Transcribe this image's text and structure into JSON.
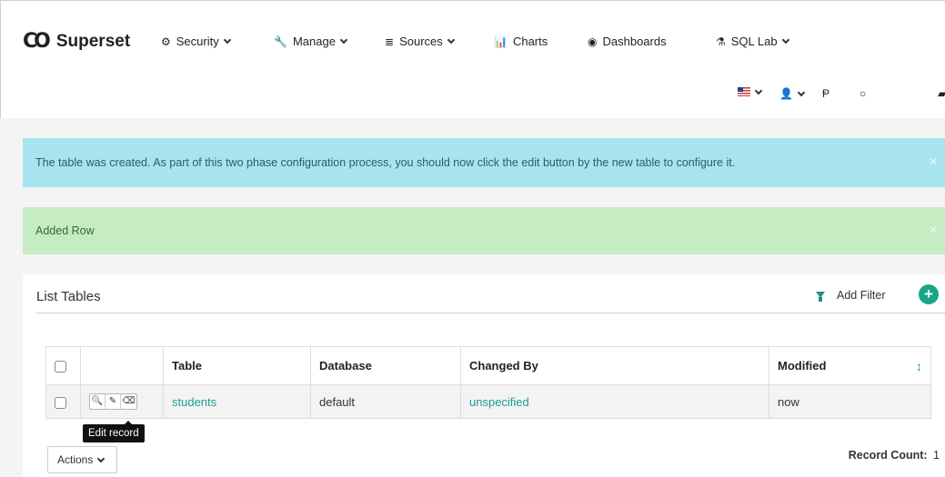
{
  "brand": {
    "logo": "CO",
    "name": "Superset"
  },
  "nav": {
    "security": "Security",
    "manage": "Manage",
    "sources": "Sources",
    "charts": "Charts",
    "dashboards": "Dashboards",
    "sqllab": "SQL Lab"
  },
  "alerts": {
    "info": "The table was created. As part of this two phase configuration process, you should now click the edit button by the new table to configure it.",
    "success": "Added Row",
    "close": "×"
  },
  "panel": {
    "title": "List Tables",
    "add_filter": "Add Filter",
    "add": "+"
  },
  "table": {
    "headers": {
      "table": "Table",
      "database": "Database",
      "changed_by": "Changed By",
      "modified": "Modified"
    },
    "rows": [
      {
        "table": "students",
        "database": "default",
        "changed_by": "unspecified",
        "modified": "now"
      }
    ]
  },
  "tooltip": "Edit record",
  "footer": {
    "actions": "Actions",
    "record_count_label": "Record Count:",
    "record_count": "1"
  }
}
